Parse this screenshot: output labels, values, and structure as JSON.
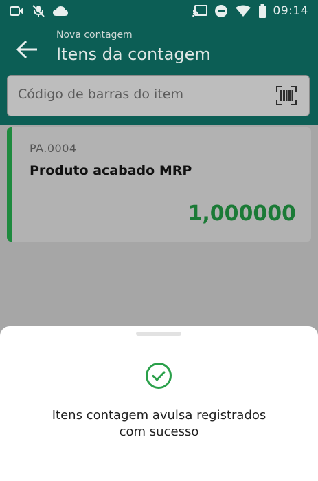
{
  "status_bar": {
    "time": "09:14",
    "left_icons": [
      "video-icon",
      "mic-off-icon",
      "cloud-icon"
    ],
    "right_icons": [
      "cast-icon",
      "do-not-disturb-icon",
      "wifi-icon",
      "battery-icon"
    ]
  },
  "app_bar": {
    "subtitle": "Nova contagem",
    "title": "Itens da contagem",
    "back_icon": "arrow-left-icon"
  },
  "search": {
    "placeholder": "Código de barras do item",
    "scan_icon": "barcode-scan-icon"
  },
  "items": [
    {
      "code": "PA.0004",
      "name": "Produto acabado MRP",
      "quantity": "1,000000"
    }
  ],
  "sheet": {
    "icon": "check-circle-icon",
    "message_line1": "Itens contagem avulsa registrados",
    "message_line2": "com sucesso"
  },
  "colors": {
    "primary": "#0c5e55",
    "accent_green": "#1e8a3e",
    "quantity_green": "#1b7a36",
    "success_icon": "#2aa04a"
  }
}
